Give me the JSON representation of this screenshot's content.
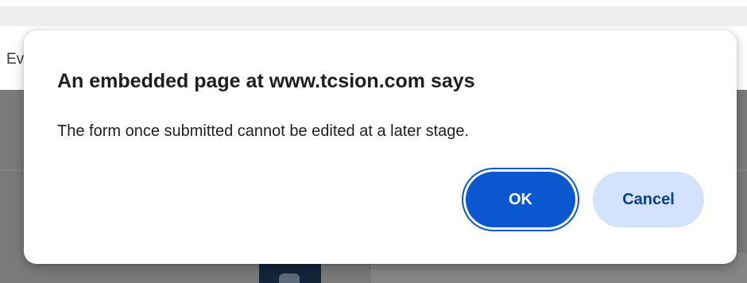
{
  "background": {
    "partial_label": "Ev"
  },
  "dialog": {
    "title": "An embedded page at www.tcsion.com says",
    "message": "The form once submitted cannot be edited at a later stage.",
    "ok_label": "OK",
    "cancel_label": "Cancel"
  },
  "colors": {
    "primary_button": "#0b57d0",
    "secondary_button": "#d3e3fd",
    "secondary_button_text": "#0b3f8f",
    "backdrop_panel": "#7a7a7a"
  }
}
